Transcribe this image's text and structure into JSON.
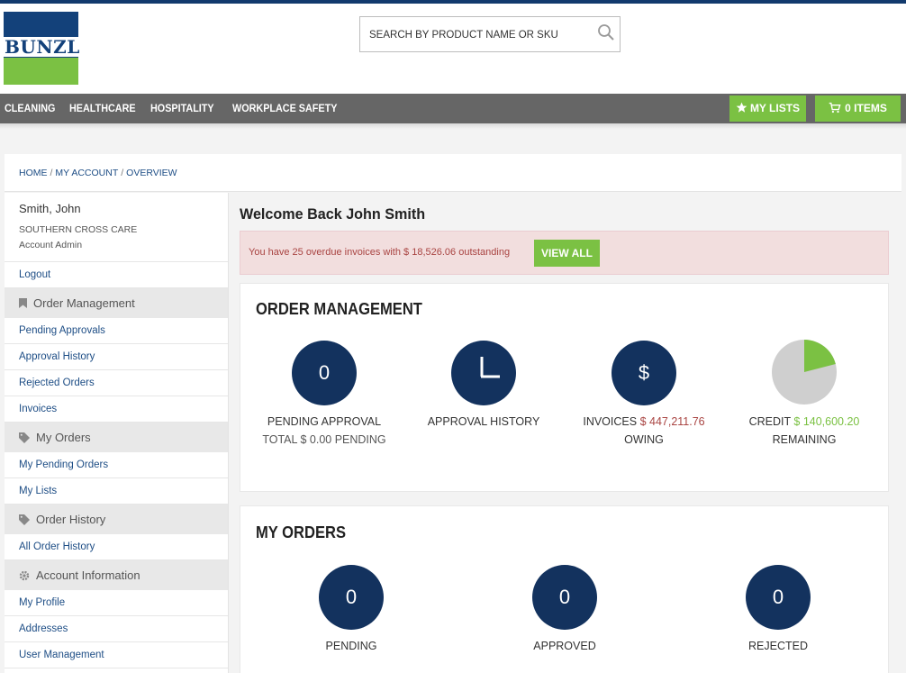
{
  "brand": {
    "logo_text": "BUNZL",
    "colors": {
      "navy": "#13417a",
      "green": "#7bc143",
      "nav": "#666666"
    }
  },
  "search": {
    "placeholder": "SEARCH BY PRODUCT NAME OR SKU",
    "icon": "search-icon"
  },
  "nav": {
    "items": [
      "CLEANING",
      "HEALTHCARE",
      "HOSPITALITY",
      "WORKPLACE SAFETY"
    ],
    "my_lists": "MY LISTS",
    "cart": "0 ITEMS"
  },
  "breadcrumb": {
    "home": "HOME",
    "account": "MY ACCOUNT",
    "current": "OVERVIEW",
    "separator": "/"
  },
  "sidebar": {
    "user": {
      "name": "Smith, John",
      "org": "SOUTHERN CROSS CARE",
      "role": "Account Admin"
    },
    "logout": "Logout",
    "sections": [
      {
        "heading": "Order Management",
        "icon": "bookmark-icon",
        "links": [
          "Pending Approvals",
          "Approval History",
          "Rejected Orders",
          "Invoices"
        ]
      },
      {
        "heading": "My Orders",
        "icon": "tag-icon",
        "links": [
          "My Pending Orders",
          "My Lists"
        ]
      },
      {
        "heading": "Order History",
        "icon": "tag-icon",
        "links": [
          "All Order History"
        ]
      },
      {
        "heading": "Account Information",
        "icon": "gear-icon",
        "links": [
          "My Profile",
          "Addresses",
          "User Management"
        ]
      }
    ]
  },
  "main": {
    "welcome": "Welcome Back John Smith",
    "alert": {
      "message": "You have 25 overdue invoices with $ 18,526.06 outstanding",
      "button": "VIEW ALL"
    },
    "order_management": {
      "title": "ORDER MANAGEMENT",
      "pending": {
        "value": "0",
        "label": "PENDING APPROVAL",
        "sub": "TOTAL $ 0.00 PENDING"
      },
      "history": {
        "label": "APPROVAL HISTORY"
      },
      "invoices": {
        "symbol": "$",
        "label": "INVOICES",
        "amount": "$ 447,211.76",
        "sub": "OWING"
      },
      "credit": {
        "label": "CREDIT",
        "amount": "$ 140,600.20",
        "sub": "REMAINING",
        "fraction": 0.21
      }
    },
    "my_orders": {
      "title": "MY ORDERS",
      "pending": {
        "value": "0",
        "label": "PENDING"
      },
      "approved": {
        "value": "0",
        "label": "APPROVED"
      },
      "rejected": {
        "value": "0",
        "label": "REJECTED"
      }
    }
  }
}
